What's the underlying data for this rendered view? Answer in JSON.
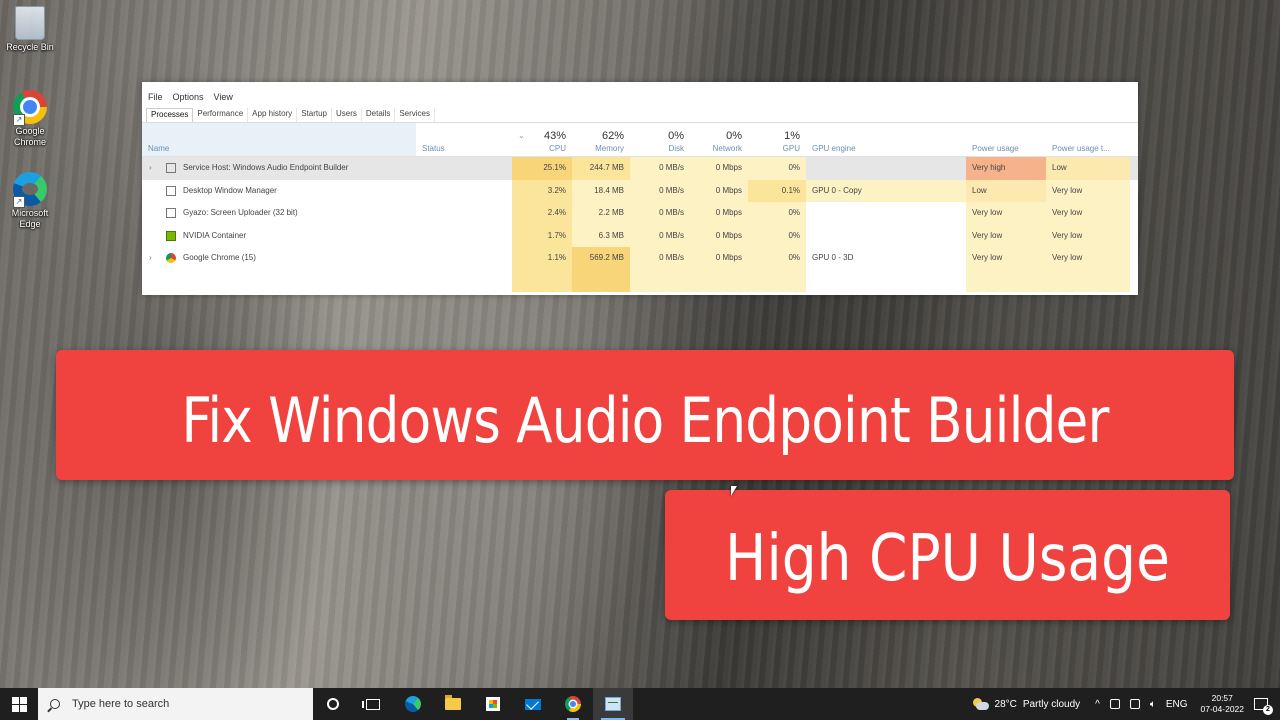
{
  "desktop": {
    "icons": [
      {
        "label": "Recycle Bin",
        "icon": "recycle-bin-icon"
      },
      {
        "label": "Google Chrome",
        "icon": "chrome-icon"
      },
      {
        "label": "Microsoft Edge",
        "icon": "edge-icon"
      }
    ]
  },
  "task_manager": {
    "menu": [
      "File",
      "Options",
      "View"
    ],
    "tabs": [
      "Processes",
      "Performance",
      "App history",
      "Startup",
      "Users",
      "Details",
      "Services"
    ],
    "active_tab": "Processes",
    "columns": {
      "name": "Name",
      "status": "Status",
      "cpu": {
        "label": "CPU",
        "pct": "43%"
      },
      "memory": {
        "label": "Memory",
        "pct": "62%"
      },
      "disk": {
        "label": "Disk",
        "pct": "0%"
      },
      "network": {
        "label": "Network",
        "pct": "0%"
      },
      "gpu": {
        "label": "GPU",
        "pct": "1%"
      },
      "gpu_engine": "GPU engine",
      "power_usage": "Power usage",
      "power_usage_trend": "Power usage t..."
    },
    "processes": [
      {
        "name": "Service Host: Windows Audio Endpoint Builder",
        "expandable": true,
        "cpu": "25.1%",
        "memory": "244.7 MB",
        "disk": "0 MB/s",
        "network": "0 Mbps",
        "gpu": "0%",
        "gpu_engine": "",
        "power": "Very high",
        "power_trend": "Low"
      },
      {
        "name": "Desktop Window Manager",
        "expandable": false,
        "cpu": "3.2%",
        "memory": "18.4 MB",
        "disk": "0 MB/s",
        "network": "0 Mbps",
        "gpu": "0.1%",
        "gpu_engine": "GPU 0 - Copy",
        "power": "Low",
        "power_trend": "Very low"
      },
      {
        "name": "Gyazo: Screen Uploader (32 bit)",
        "expandable": false,
        "cpu": "2.4%",
        "memory": "2.2 MB",
        "disk": "0 MB/s",
        "network": "0 Mbps",
        "gpu": "0%",
        "gpu_engine": "",
        "power": "Very low",
        "power_trend": "Very low"
      },
      {
        "name": "NVIDIA Container",
        "expandable": false,
        "cpu": "1.7%",
        "memory": "6.3 MB",
        "disk": "0 MB/s",
        "network": "0 Mbps",
        "gpu": "0%",
        "gpu_engine": "",
        "power": "Very low",
        "power_trend": "Very low"
      },
      {
        "name": "Google Chrome (15)",
        "expandable": true,
        "cpu": "1.1%",
        "memory": "569.2 MB",
        "disk": "0 MB/s",
        "network": "0 Mbps",
        "gpu": "0%",
        "gpu_engine": "GPU 0 - 3D",
        "power": "Very low",
        "power_trend": "Very low"
      }
    ]
  },
  "banner": {
    "line1": "Fix Windows Audio Endpoint Builder",
    "line2": "High CPU Usage",
    "color": "#f0423f"
  },
  "taskbar": {
    "search_placeholder": "Type here to search",
    "pinned": [
      "cortana-icon",
      "task-view-icon",
      "edge-icon",
      "file-explorer-icon",
      "store-icon",
      "mail-icon",
      "chrome-icon",
      "task-manager-icon"
    ],
    "weather_temp": "28°C",
    "weather_text": "Partly cloudy",
    "language": "ENG",
    "time": "20:57",
    "date": "07-04-2022",
    "notification_count": "2"
  }
}
